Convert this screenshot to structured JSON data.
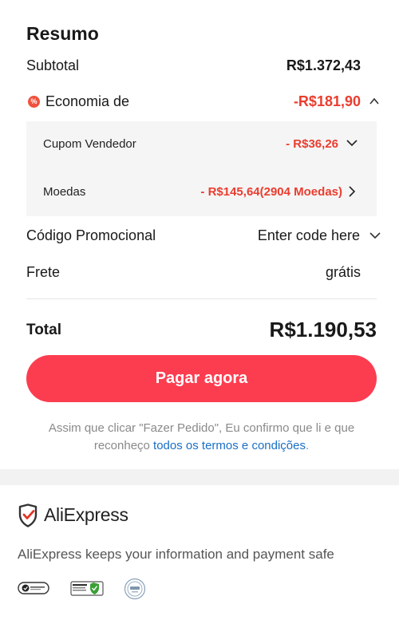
{
  "summary": {
    "title": "Resumo",
    "subtotal_label": "Subtotal",
    "subtotal_value": "R$1.372,43",
    "savings_icon": "%",
    "savings_label": "Economia de",
    "savings_value": "-R$181,90",
    "coupon_label": "Cupom Vendedor",
    "coupon_value": "- R$36,26",
    "coins_label": "Moedas",
    "coins_value": "- R$145,64(2904 Moedas)",
    "promo_label": "Código Promocional",
    "promo_value": "Enter code here",
    "shipping_label": "Frete",
    "shipping_value": "grátis",
    "total_label": "Total",
    "total_value": "R$1.190,53"
  },
  "actions": {
    "pay_label": "Pagar agora"
  },
  "legal": {
    "text_before": "Assim que clicar \"Fazer Pedido\", Eu confirmo que li e que reconheço ",
    "link_text": "todos os termos e condições",
    "text_after": "."
  },
  "footer": {
    "brand": "AliExpress",
    "safe_text": "AliExpress keeps your information and payment safe"
  },
  "colors": {
    "accent": "#fc3d50",
    "discount": "#ea3d2f",
    "link": "#1a6fc4"
  },
  "icons": [
    "percent-badge-icon",
    "chevron-up-icon",
    "chevron-down-icon",
    "chevron-right-icon",
    "aliexpress-shield-logo-icon",
    "norton-badge-icon",
    "ssl-secure-badge-icon",
    "pci-badge-icon"
  ]
}
